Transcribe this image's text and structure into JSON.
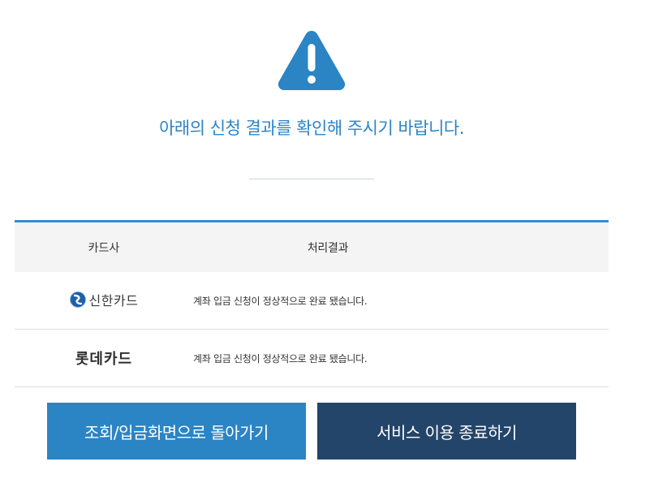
{
  "headline": "아래의 신청 결과를 확인해 주시기 바랍니다.",
  "table": {
    "headers": {
      "company": "카드사",
      "result": "처리결과"
    },
    "rows": [
      {
        "company": "신한카드",
        "result": "계좌 입금 신청이 정상적으로 완료 됐습니다."
      },
      {
        "company": "롯데카드",
        "result": "계좌 입금 신청이 정상적으로 완료 됐습니다."
      }
    ]
  },
  "buttons": {
    "back": "조회/입금화면으로 돌아가기",
    "exit": "서비스 이용 종료하기"
  },
  "colors": {
    "accent": "#2b84c4",
    "dark": "#24456a"
  },
  "icons": {
    "alert": "warning-triangle-icon",
    "shinhan": "shinhan-logo-icon"
  }
}
